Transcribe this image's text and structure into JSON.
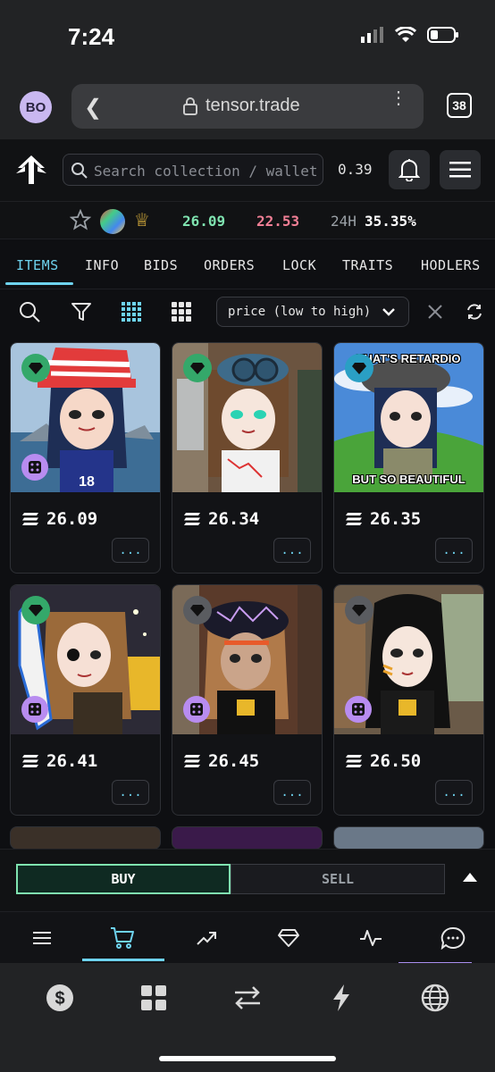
{
  "status": {
    "time": "7:24"
  },
  "browser": {
    "profile": "BO",
    "url": "tensor.trade",
    "tabs_count": "38"
  },
  "header": {
    "search_placeholder": "Search collection / wallet",
    "sol_price": "0.39"
  },
  "stats": {
    "floor": "26.09",
    "top_bid": "22.53",
    "h24_label": "24H",
    "h24_value": "35.35%"
  },
  "tabs": [
    "ITEMS",
    "INFO",
    "BIDS",
    "ORDERS",
    "LOCK",
    "TRAITS",
    "HODLERS"
  ],
  "sort": {
    "value": "price (low to high)"
  },
  "items": [
    {
      "price": "26.09",
      "more": "...",
      "gem": "green",
      "art": "hat-stripes"
    },
    {
      "price": "26.34",
      "more": "...",
      "gem": "green",
      "art": "goggles"
    },
    {
      "price": "26.35",
      "more": "...",
      "gem": "teal",
      "art": "xp-meme",
      "top_text": "THAT'S RETARDIO",
      "bottom_text": "BUT SO BEAUTIFUL"
    },
    {
      "price": "26.41",
      "more": "...",
      "gem": "green",
      "art": "surfboard"
    },
    {
      "price": "26.45",
      "more": "...",
      "gem": "gray",
      "art": "lightning"
    },
    {
      "price": "26.50",
      "more": "...",
      "gem": "gray",
      "art": "blackhair"
    }
  ],
  "actions": {
    "buy": "BUY",
    "sell": "SELL"
  },
  "colors": {
    "accent": "#6ed3ef",
    "green": "#7fe3b0",
    "pink": "#f07f95",
    "purple": "#b88cf0"
  }
}
